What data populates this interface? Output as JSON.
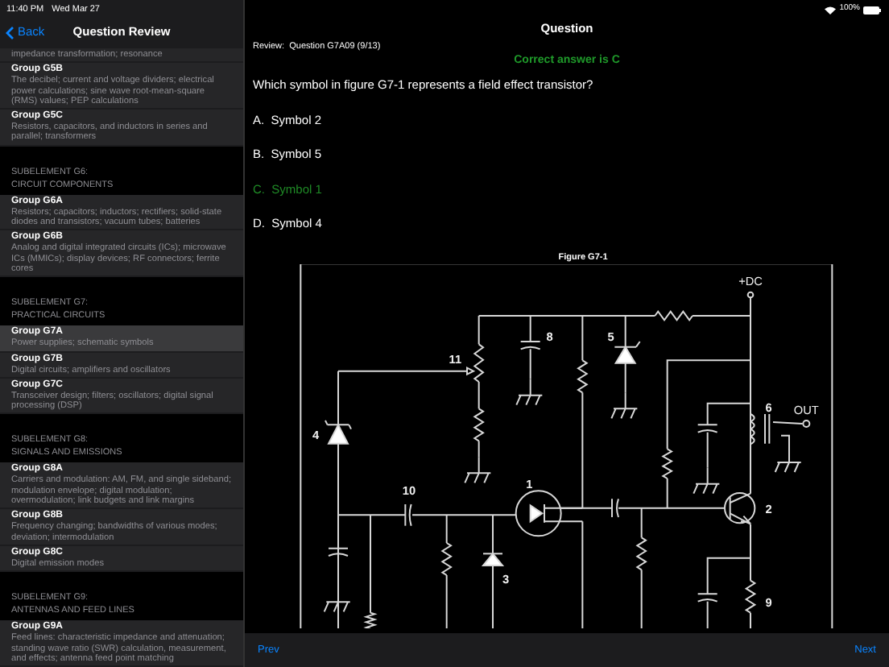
{
  "status_bar": {
    "time": "11:40 PM",
    "date": "Wed Mar 27",
    "battery": "100%"
  },
  "sidebar": {
    "back": "Back",
    "title": "Question Review",
    "sections": [
      {
        "groups": [
          {
            "description": "impedance transformation; resonance",
            "selected": false
          },
          {
            "title": "Group G5B",
            "description": "The decibel; current and voltage dividers; electrical power calculations; sine wave root-mean-square (RMS) values; PEP calculations",
            "selected": false
          },
          {
            "title": "Group G5C",
            "description": "Resistors, capacitors, and inductors in series and parallel; transformers",
            "selected": false
          }
        ]
      },
      {
        "header": [
          "SUBELEMENT G6:",
          "CIRCUIT COMPONENTS"
        ],
        "groups": [
          {
            "title": "Group G6A",
            "description": "Resistors; capacitors; inductors; rectifiers; solid-state diodes and transistors; vacuum tubes; batteries",
            "selected": false
          },
          {
            "title": "Group G6B",
            "description": "Analog and digital integrated circuits (ICs); microwave ICs (MMICs); display devices; RF connectors; ferrite cores",
            "selected": false
          }
        ]
      },
      {
        "header": [
          "SUBELEMENT G7:",
          "PRACTICAL CIRCUITS"
        ],
        "groups": [
          {
            "title": "Group G7A",
            "description": "Power supplies; schematic symbols",
            "selected": true
          },
          {
            "title": "Group G7B",
            "description": "Digital circuits; amplifiers and oscillators",
            "selected": false
          },
          {
            "title": "Group G7C",
            "description": "Transceiver design; filters; oscillators; digital signal processing (DSP)",
            "selected": false
          }
        ]
      },
      {
        "header": [
          "SUBELEMENT G8:",
          "SIGNALS AND EMISSIONS"
        ],
        "groups": [
          {
            "title": "Group G8A",
            "description": "Carriers and modulation: AM, FM, and single sideband; modulation envelope; digital modulation; overmodulation; link budgets and link margins",
            "selected": false
          },
          {
            "title": "Group G8B",
            "description": "Frequency changing; bandwidths of various modes; deviation; intermodulation",
            "selected": false
          },
          {
            "title": "Group G8C",
            "description": "Digital emission modes",
            "selected": false
          }
        ]
      },
      {
        "header": [
          "SUBELEMENT G9:",
          "ANTENNAS AND FEED LINES"
        ],
        "groups": [
          {
            "title": "Group G9A",
            "description": "Feed lines: characteristic impedance and attenuation; standing wave ratio (SWR) calculation, measurement, and effects; antenna feed point matching",
            "selected": false
          }
        ]
      }
    ]
  },
  "main": {
    "title": "Question",
    "review": "Review:  Question G7A09 (9/13)",
    "result": "Correct answer is C",
    "question": "Which symbol in figure G7-1 represents a field effect transistor?",
    "answers": [
      {
        "text": "A.  Symbol 2",
        "correct": false
      },
      {
        "text": "B.  Symbol 5",
        "correct": false
      },
      {
        "text": "C.  Symbol 1",
        "correct": true
      },
      {
        "text": "D.  Symbol 4",
        "correct": false
      }
    ],
    "figure": {
      "title": "Figure G7-1",
      "labels": [
        "+DC",
        "OUT",
        "1",
        "2",
        "3",
        "4",
        "5",
        "6",
        "8",
        "9",
        "10",
        "11"
      ]
    }
  },
  "toolbar": {
    "prev": "Prev",
    "next": "Next"
  }
}
